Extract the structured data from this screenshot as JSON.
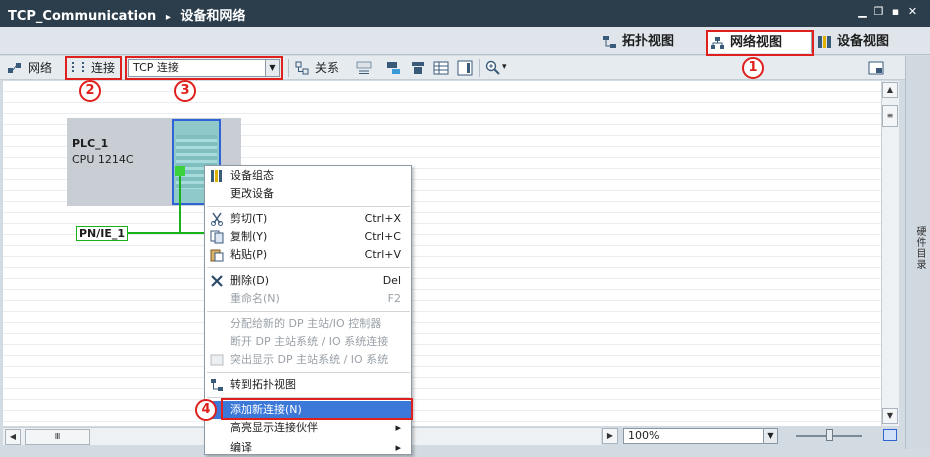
{
  "titlebar": {
    "project": "TCP_Communication",
    "separator": "▸",
    "location": "设备和网络"
  },
  "view_tabs": [
    {
      "label": "拓扑视图",
      "icon": "topology-icon",
      "active": false
    },
    {
      "label": "网络视图",
      "icon": "network-icon",
      "active": true
    },
    {
      "label": "设备视图",
      "icon": "device-icon",
      "active": false
    }
  ],
  "toolbar": {
    "network_label": "网络",
    "connections_label": "连接",
    "connection_type": "TCP 连接",
    "relations_label": "关系"
  },
  "device": {
    "name": "PLC_1",
    "type": "CPU 1214C"
  },
  "subnet": {
    "label": "PN/IE_1"
  },
  "context_menu": {
    "items": [
      {
        "label": "设备组态",
        "shortcut": "",
        "disabled": false,
        "icon": "device-config-icon"
      },
      {
        "label": "更改设备",
        "shortcut": "",
        "disabled": false,
        "icon": ""
      },
      {
        "label": "剪切(T)",
        "shortcut": "Ctrl+X",
        "disabled": false,
        "icon": "cut-icon"
      },
      {
        "label": "复制(Y)",
        "shortcut": "Ctrl+C",
        "disabled": false,
        "icon": "copy-icon"
      },
      {
        "label": "粘贴(P)",
        "shortcut": "Ctrl+V",
        "disabled": false,
        "icon": "paste-icon"
      },
      {
        "label": "删除(D)",
        "shortcut": "Del",
        "disabled": false,
        "icon": "delete-icon"
      },
      {
        "label": "重命名(N)",
        "shortcut": "F2",
        "disabled": true,
        "icon": ""
      },
      {
        "label": "分配给新的 DP 主站/IO 控制器",
        "shortcut": "",
        "disabled": true,
        "icon": ""
      },
      {
        "label": "断开 DP 主站系统 / IO 系统连接",
        "shortcut": "",
        "disabled": true,
        "icon": ""
      },
      {
        "label": "突出显示 DP 主站系统 / IO 系统",
        "shortcut": "",
        "disabled": true,
        "icon": "highlight-icon"
      },
      {
        "label": "转到拓扑视图",
        "shortcut": "",
        "disabled": false,
        "icon": "topology-icon"
      },
      {
        "label": "添加新连接(N)",
        "shortcut": "",
        "disabled": false,
        "icon": "",
        "selected": true
      },
      {
        "label": "高亮显示连接伙伴",
        "shortcut": "▸",
        "disabled": false,
        "icon": ""
      },
      {
        "label": "编译",
        "shortcut": "▸",
        "disabled": false,
        "icon": ""
      }
    ]
  },
  "zoom": {
    "value": "100%"
  },
  "side_panel": {
    "label": "硬件目录"
  },
  "annotations": [
    "1",
    "2",
    "3",
    "4"
  ],
  "colors": {
    "title_bg": "#2c3e4c",
    "highlight_red": "#e0201c",
    "selection_blue": "#3b78d8",
    "network_green": "#19b319"
  }
}
